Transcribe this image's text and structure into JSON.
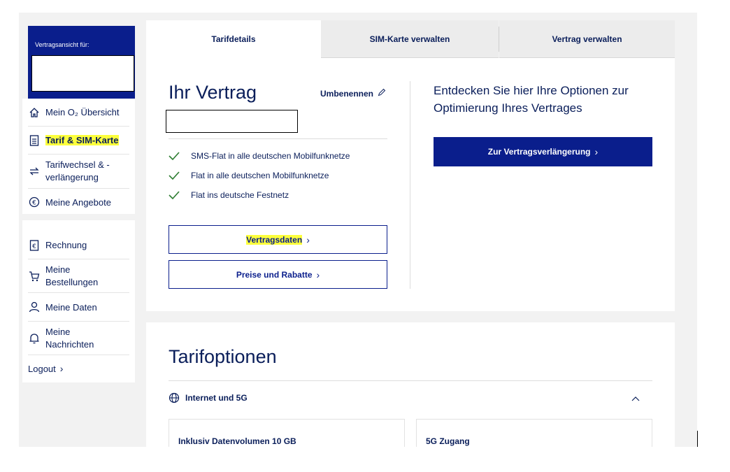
{
  "sidebar": {
    "account_label": "Vertragsansicht für:",
    "nav_primary": [
      {
        "label": "Mein O₂ Übersicht",
        "icon": "home-icon"
      },
      {
        "label": "Tarif & SIM-Karte",
        "icon": "document-icon"
      },
      {
        "label": "Tarifwechsel & -verlängerung",
        "icon": "swap-icon"
      },
      {
        "label": "Meine Angebote",
        "icon": "euro-badge-icon"
      }
    ],
    "nav_secondary": [
      {
        "label": "Rechnung",
        "icon": "invoice-icon"
      },
      {
        "label": "Meine Bestellungen",
        "icon": "cart-icon"
      },
      {
        "label": "Meine Daten",
        "icon": "user-icon"
      },
      {
        "label": "Meine Nachrichten",
        "icon": "bell-icon"
      }
    ],
    "logout_label": "Logout"
  },
  "tabs": [
    {
      "label": "Tarifdetails",
      "active": true
    },
    {
      "label": "SIM-Karte verwalten",
      "active": false
    },
    {
      "label": "Vertrag verwalten",
      "active": false
    }
  ],
  "contract": {
    "title": "Ihr Vertrag",
    "rename_label": "Umbenennen",
    "features": [
      "SMS-Flat in alle deutschen Mobilfunknetze",
      "Flat in alle deutschen Mobilfunknetze",
      "Flat ins deutsche Festnetz"
    ],
    "contract_data_button": "Vertragsdaten",
    "prices_button": "Preise und Rabatte"
  },
  "promo": {
    "text": "Entdecken Sie hier Ihre Optionen zur Optimierung Ihres Vertrages",
    "button_label": "Zur Vertragsverlängerung"
  },
  "options": {
    "title": "Tarifoptionen",
    "category": "Internet und 5G",
    "cards": [
      "Inklusiv Datenvolumen 10 GB",
      "5G Zugang"
    ]
  },
  "colors": {
    "brand_navy": "#0a1e8c",
    "text_navy": "#0a1e5a",
    "highlight": "#fcff3c",
    "check_green": "#2e7d32",
    "background": "#f2f2f2"
  }
}
